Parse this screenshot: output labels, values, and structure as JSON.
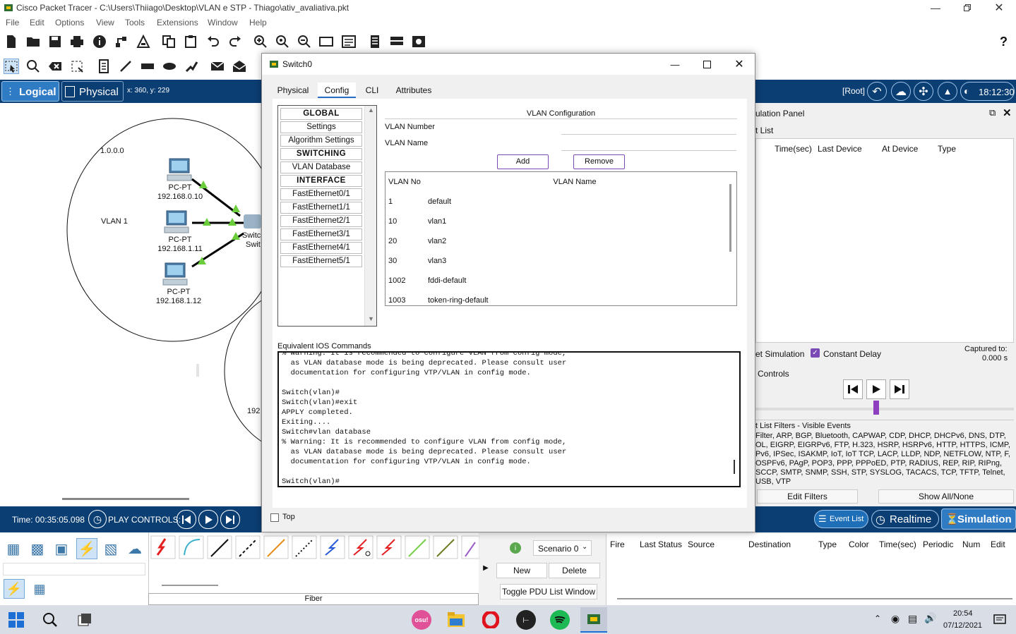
{
  "window": {
    "title": "Cisco Packet Tracer - C:\\Users\\Thiiago\\Desktop\\VLAN e STP - Thiago\\ativ_avaliativa.pkt"
  },
  "menu": [
    "File",
    "Edit",
    "Options",
    "View",
    "Tools",
    "Extensions",
    "Window",
    "Help"
  ],
  "toolbar1": [
    "new-icon",
    "open-icon",
    "save-icon",
    "print-icon",
    "info-icon",
    "network-wizard-icon",
    "activity-wizard-icon",
    "copy-icon",
    "paste-icon",
    "undo-icon",
    "redo-icon",
    "zoom-in-icon",
    "zoom-reset-icon",
    "zoom-out-icon",
    "drawing-palette-icon",
    "custom-devices-icon",
    "notes-icon",
    "device-template-icon",
    "screenshot-icon"
  ],
  "toolbar2": [
    "select-icon",
    "inspect-icon",
    "delete-icon",
    "resize-icon",
    "note-icon",
    "line-icon",
    "rectangle-icon",
    "ellipse-icon",
    "freeform-icon",
    "simple-pdu-icon",
    "complex-pdu-icon"
  ],
  "help_glyph": "?",
  "workspace_bar": {
    "logical": "Logical",
    "physical": "Physical",
    "coords": "x: 360, y: 229",
    "root": "[Root]",
    "clock": "18:12:30"
  },
  "topology": {
    "network_label": "1.0.0.0",
    "vlan_label": "VLAN 1",
    "pcs": [
      {
        "type": "PC-PT",
        "ip": "192.168.0.10"
      },
      {
        "type": "PC-PT",
        "ip": "192.168.1.11"
      },
      {
        "type": "PC-PT",
        "ip": "192.168.1.12"
      }
    ],
    "switch_label_a": "Switc",
    "switch_label_b": "Swit",
    "partial_ip": "192"
  },
  "dialog": {
    "title": "Switch0",
    "tabs": [
      "Physical",
      "Config",
      "CLI",
      "Attributes"
    ],
    "active_tab": "Config",
    "side_menu": [
      {
        "label": "GLOBAL",
        "header": true
      },
      {
        "label": "Settings",
        "header": false
      },
      {
        "label": "Algorithm Settings",
        "header": false
      },
      {
        "label": "SWITCHING",
        "header": true
      },
      {
        "label": "VLAN Database",
        "header": false
      },
      {
        "label": "INTERFACE",
        "header": true
      },
      {
        "label": "FastEthernet0/1",
        "header": false
      },
      {
        "label": "FastEthernet1/1",
        "header": false
      },
      {
        "label": "FastEthernet2/1",
        "header": false
      },
      {
        "label": "FastEthernet3/1",
        "header": false
      },
      {
        "label": "FastEthernet4/1",
        "header": false
      },
      {
        "label": "FastEthernet5/1",
        "header": false
      }
    ],
    "vlan_config_title": "VLAN Configuration",
    "vlan_number_label": "VLAN Number",
    "vlan_number_value": "",
    "vlan_name_label": "VLAN Name",
    "vlan_name_value": "",
    "add_button": "Add",
    "remove_button": "Remove",
    "table_headers": [
      "VLAN No",
      "VLAN Name"
    ],
    "vlans": [
      {
        "no": "1",
        "name": "default"
      },
      {
        "no": "10",
        "name": "vlan1"
      },
      {
        "no": "20",
        "name": "vlan2"
      },
      {
        "no": "30",
        "name": "vlan3"
      },
      {
        "no": "1002",
        "name": "fddi-default"
      },
      {
        "no": "1003",
        "name": "token-ring-default"
      }
    ],
    "ios_label": "Equivalent IOS Commands",
    "ios_lines": [
      "% Warning: It is recommended to configure VLAN from config mode,",
      "  as VLAN database mode is being deprecated. Please consult user",
      "  documentation for configuring VTP/VLAN in config mode.",
      "",
      "Switch(vlan)#",
      "Switch(vlan)#exit",
      "APPLY completed.",
      "Exiting....",
      "Switch#vlan database",
      "% Warning: It is recommended to configure VLAN from config mode,",
      "  as VLAN database mode is being deprecated. Please consult user",
      "  documentation for configuring VTP/VLAN in config mode.",
      "",
      "Switch(vlan)#"
    ],
    "top_checkbox_label": "Top"
  },
  "sim_panel": {
    "title": "ulation Panel",
    "event_list_label": "t List",
    "columns": [
      "Time(sec)",
      "Last Device",
      "At Device",
      "Type"
    ],
    "reset_label": "et Simulation",
    "constant_delay_label": "Constant Delay",
    "captured_label": "Captured to:",
    "captured_value": "0.000 s",
    "controls_label": "Controls",
    "filters_title": "t List Filters - Visible Events",
    "filters_text": "Filter, ARP, BGP, Bluetooth, CAPWAP, CDP, DHCP, DHCPv6, DNS, DTP, OL, EIGRP, EIGRPv6, FTP, H.323, HSRP, HSRPv6, HTTP, HTTPS, ICMP, Pv6, IPSec, ISAKMP, IoT, IoT TCP, LACP, LLDP, NDP, NETFLOW, NTP, F, OSPFv6, PAgP, POP3, PPP, PPPoED, PTP, RADIUS, REP, RIP, RIPng, SCCP, SMTP, SNMP, SSH, STP, SYSLOG, TACACS, TCP, TFTP, Telnet, USB, VTP",
    "edit_filters": "Edit Filters",
    "show_all": "Show All/None"
  },
  "statusbar": {
    "time": "Time: 00:35:05.098",
    "play_controls": "PLAY CONTROLS:",
    "event_list_btn": "Event List",
    "realtime_btn": "Realtime",
    "simulation_btn": "Simulation"
  },
  "bottom": {
    "connection_label": "Fiber",
    "scenario": "Scenario 0",
    "new_btn": "New",
    "delete_btn": "Delete",
    "toggle_btn": "Toggle PDU List Window",
    "pdu_columns": [
      "Fire",
      "Last Status",
      "Source",
      "Destination",
      "Type",
      "Color",
      "Time(sec)",
      "Periodic",
      "Num",
      "Edit"
    ]
  },
  "taskbar": {
    "time": "20:54",
    "date": "07/12/2021"
  },
  "colors": {
    "accent": "#1b6fb5",
    "sim_blue": "#1f7ac0",
    "selected_tab": "#2b6cc4"
  }
}
